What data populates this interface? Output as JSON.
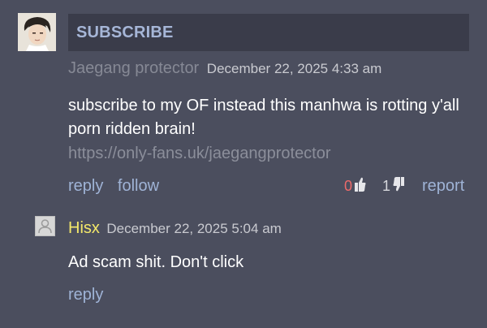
{
  "comment1": {
    "avatar": "anime-portrait-avatar",
    "banner": "SUBSCRIBE",
    "author": "Jaegang protector",
    "date": "December 22, 2025 4:33 am",
    "body": "subscribe to my OF instead this manhwa is rotting y'all porn ridden brain!",
    "link": "https://only-fans.uk/jaegangprotector",
    "reply": "reply",
    "follow": "follow",
    "upvotes": "0",
    "downvotes": "1",
    "report": "report"
  },
  "comment2": {
    "avatar": "default-user-avatar",
    "author": "Hisx",
    "date": "December 22, 2025 5:04 am",
    "body": "Ad scam shit. Don't click",
    "reply": "reply"
  },
  "colors": {
    "background": "#4b4e5e",
    "banner_bg": "#3a3c4a",
    "link": "#9fb3d6",
    "author_highlight": "#f3e86a",
    "upvote": "#ee6a6a"
  }
}
